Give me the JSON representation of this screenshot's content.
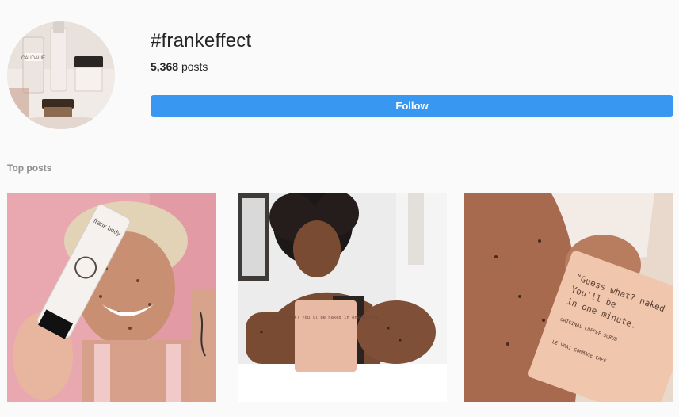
{
  "header": {
    "hashtag": "#frankeffect",
    "posts_count": "5,368",
    "posts_label": "posts",
    "follow_label": "Follow"
  },
  "avatar": {
    "bottle_label": "CAUDALIE"
  },
  "top_posts": {
    "label": "Top posts",
    "items": [
      {
        "tube_brand": "frank body",
        "colors": {
          "background": "#e9a8b0",
          "skin": "#c98f72"
        }
      },
      {
        "pouch_text": "Guess what? You'll be naked in one minute.",
        "colors": {
          "background": "#ececec",
          "pouch": "#e8b9a3"
        }
      },
      {
        "pouch_text_line1": "\"Guess what? naked",
        "pouch_text_line2": "You'll be",
        "pouch_text_line3": "in one minute.",
        "pouch_small_1": "ORIGINAL COFFEE SCRUB",
        "pouch_small_2": "LE VRAI GOMMAGE CAFE",
        "colors": {
          "background": "#e9d8cc",
          "pouch": "#f0c6ad"
        }
      }
    ]
  },
  "colors": {
    "accent": "#3897f0",
    "background": "#fafafa",
    "text_primary": "#262626",
    "text_secondary": "#8e8e8e"
  }
}
